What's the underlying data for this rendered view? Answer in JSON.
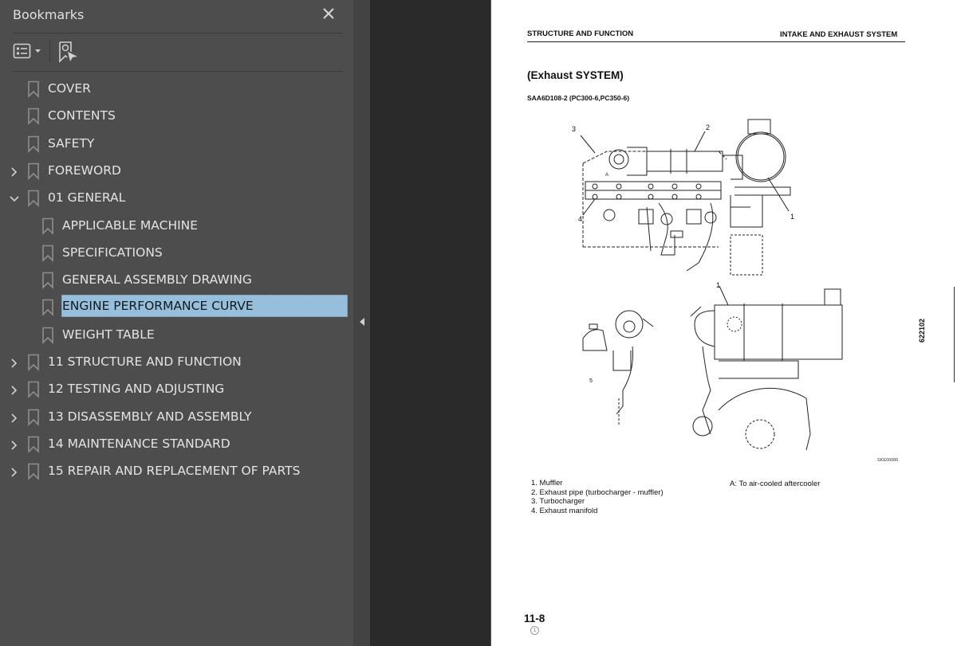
{
  "sidebar": {
    "title": "Bookmarks",
    "close_icon": "close-icon",
    "toolbar": {
      "options_icon": "list-options-icon",
      "find_icon": "find-current-bookmark-icon"
    },
    "items": [
      {
        "label": "COVER",
        "level": 0,
        "expandable": false,
        "expanded": false,
        "selected": false
      },
      {
        "label": "CONTENTS",
        "level": 0,
        "expandable": false,
        "expanded": false,
        "selected": false
      },
      {
        "label": "SAFETY",
        "level": 0,
        "expandable": false,
        "expanded": false,
        "selected": false
      },
      {
        "label": "FOREWORD",
        "level": 0,
        "expandable": true,
        "expanded": false,
        "selected": false
      },
      {
        "label": "01 GENERAL",
        "level": 0,
        "expandable": true,
        "expanded": true,
        "selected": false
      },
      {
        "label": "APPLICABLE MACHINE",
        "level": 1,
        "expandable": false,
        "expanded": false,
        "selected": false
      },
      {
        "label": "SPECIFICATIONS",
        "level": 1,
        "expandable": false,
        "expanded": false,
        "selected": false
      },
      {
        "label": "GENERAL ASSEMBLY DRAWING",
        "level": 1,
        "expandable": false,
        "expanded": false,
        "selected": false
      },
      {
        "label": "ENGINE PERFORMANCE CURVE",
        "level": 1,
        "expandable": false,
        "expanded": false,
        "selected": true
      },
      {
        "label": "WEIGHT TABLE",
        "level": 1,
        "expandable": false,
        "expanded": false,
        "selected": false
      },
      {
        "label": "11 STRUCTURE AND FUNCTION",
        "level": 0,
        "expandable": true,
        "expanded": false,
        "selected": false
      },
      {
        "label": "12 TESTING AND ADJUSTING",
        "level": 0,
        "expandable": true,
        "expanded": false,
        "selected": false
      },
      {
        "label": "13 DISASSEMBLY AND ASSEMBLY",
        "level": 0,
        "expandable": true,
        "expanded": false,
        "selected": false
      },
      {
        "label": "14 MAINTENANCE STANDARD",
        "level": 0,
        "expandable": true,
        "expanded": false,
        "selected": false
      },
      {
        "label": "15 REPAIR AND REPLACEMENT OF PARTS",
        "level": 0,
        "expandable": true,
        "expanded": false,
        "selected": false
      }
    ],
    "selected_color": "#97bfdb"
  },
  "page": {
    "header_left": "STRUCTURE AND FUNCTION",
    "header_right": "INTAKE AND EXHAUST SYSTEM",
    "section_title": "(Exhaust SYSTEM)",
    "section_subtitle": "SAA6D108-2 (PC300-6,PC350-6)",
    "callouts": [
      "1",
      "2",
      "3",
      "4",
      "1",
      "5"
    ],
    "callout_A": "A",
    "figure_code": "SKE00086",
    "side_number": "622102",
    "legend": [
      "1. Muffler",
      "2. Exhaust pipe (turbocharger - muffler)",
      "3. Turbocharger",
      "4. Exhaust manifold"
    ],
    "legend_note": "A: To air-cooled aftercooler",
    "page_number": "11-8",
    "revision_mark": "1"
  }
}
